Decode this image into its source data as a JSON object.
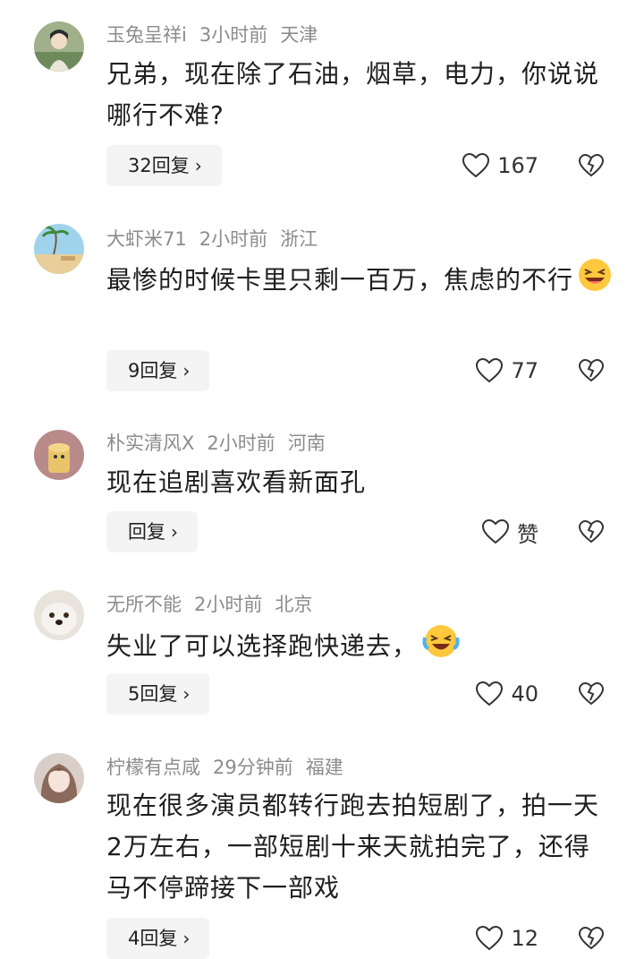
{
  "comments": [
    {
      "username": "玉兔呈祥i",
      "time": "3小时前",
      "location": "天津",
      "text": "兄弟，现在除了石油，烟草，电力，你说说哪行不难?",
      "reply_label": "32回复",
      "likes": "167"
    },
    {
      "username": "大虾米71",
      "time": "2小时前",
      "location": "浙江",
      "text": "最惨的时候卡里只剩一百万，焦虑的不行",
      "emoji": "laughing-emoji",
      "reply_label": "9回复",
      "likes": "77"
    },
    {
      "username": "朴实清风X",
      "time": "2小时前",
      "location": "河南",
      "text": "现在追剧喜欢看新面孔",
      "reply_label": "回复",
      "likes": "赞"
    },
    {
      "username": "无所不能",
      "time": "2小时前",
      "location": "北京",
      "text": "失业了可以选择跑快递去，",
      "emoji": "crying-laughing-emoji",
      "reply_label": "5回复",
      "likes": "40"
    },
    {
      "username": "柠檬有点咸",
      "time": "29分钟前",
      "location": "福建",
      "text": "现在很多演员都转行跑去拍短剧了，拍一天2万左右，一部短剧十来天就拍完了，还得马不停蹄接下一部戏",
      "reply_label": "4回复",
      "likes": "12"
    }
  ],
  "colors": {
    "meta": "#8c8c8c",
    "text": "#1f1f1f",
    "reply_bg": "#f4f4f4"
  }
}
